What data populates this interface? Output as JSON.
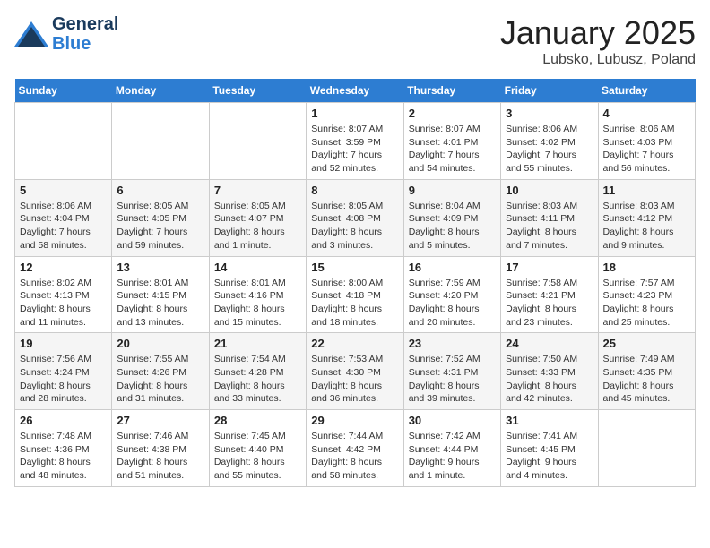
{
  "header": {
    "logo_line1": "General",
    "logo_line2": "Blue",
    "title": "January 2025",
    "subtitle": "Lubsko, Lubusz, Poland"
  },
  "weekdays": [
    "Sunday",
    "Monday",
    "Tuesday",
    "Wednesday",
    "Thursday",
    "Friday",
    "Saturday"
  ],
  "weeks": [
    [
      {
        "day": "",
        "info": ""
      },
      {
        "day": "",
        "info": ""
      },
      {
        "day": "",
        "info": ""
      },
      {
        "day": "1",
        "info": "Sunrise: 8:07 AM\nSunset: 3:59 PM\nDaylight: 7 hours and 52 minutes."
      },
      {
        "day": "2",
        "info": "Sunrise: 8:07 AM\nSunset: 4:01 PM\nDaylight: 7 hours and 54 minutes."
      },
      {
        "day": "3",
        "info": "Sunrise: 8:06 AM\nSunset: 4:02 PM\nDaylight: 7 hours and 55 minutes."
      },
      {
        "day": "4",
        "info": "Sunrise: 8:06 AM\nSunset: 4:03 PM\nDaylight: 7 hours and 56 minutes."
      }
    ],
    [
      {
        "day": "5",
        "info": "Sunrise: 8:06 AM\nSunset: 4:04 PM\nDaylight: 7 hours and 58 minutes."
      },
      {
        "day": "6",
        "info": "Sunrise: 8:05 AM\nSunset: 4:05 PM\nDaylight: 7 hours and 59 minutes."
      },
      {
        "day": "7",
        "info": "Sunrise: 8:05 AM\nSunset: 4:07 PM\nDaylight: 8 hours and 1 minute."
      },
      {
        "day": "8",
        "info": "Sunrise: 8:05 AM\nSunset: 4:08 PM\nDaylight: 8 hours and 3 minutes."
      },
      {
        "day": "9",
        "info": "Sunrise: 8:04 AM\nSunset: 4:09 PM\nDaylight: 8 hours and 5 minutes."
      },
      {
        "day": "10",
        "info": "Sunrise: 8:03 AM\nSunset: 4:11 PM\nDaylight: 8 hours and 7 minutes."
      },
      {
        "day": "11",
        "info": "Sunrise: 8:03 AM\nSunset: 4:12 PM\nDaylight: 8 hours and 9 minutes."
      }
    ],
    [
      {
        "day": "12",
        "info": "Sunrise: 8:02 AM\nSunset: 4:13 PM\nDaylight: 8 hours and 11 minutes."
      },
      {
        "day": "13",
        "info": "Sunrise: 8:01 AM\nSunset: 4:15 PM\nDaylight: 8 hours and 13 minutes."
      },
      {
        "day": "14",
        "info": "Sunrise: 8:01 AM\nSunset: 4:16 PM\nDaylight: 8 hours and 15 minutes."
      },
      {
        "day": "15",
        "info": "Sunrise: 8:00 AM\nSunset: 4:18 PM\nDaylight: 8 hours and 18 minutes."
      },
      {
        "day": "16",
        "info": "Sunrise: 7:59 AM\nSunset: 4:20 PM\nDaylight: 8 hours and 20 minutes."
      },
      {
        "day": "17",
        "info": "Sunrise: 7:58 AM\nSunset: 4:21 PM\nDaylight: 8 hours and 23 minutes."
      },
      {
        "day": "18",
        "info": "Sunrise: 7:57 AM\nSunset: 4:23 PM\nDaylight: 8 hours and 25 minutes."
      }
    ],
    [
      {
        "day": "19",
        "info": "Sunrise: 7:56 AM\nSunset: 4:24 PM\nDaylight: 8 hours and 28 minutes."
      },
      {
        "day": "20",
        "info": "Sunrise: 7:55 AM\nSunset: 4:26 PM\nDaylight: 8 hours and 31 minutes."
      },
      {
        "day": "21",
        "info": "Sunrise: 7:54 AM\nSunset: 4:28 PM\nDaylight: 8 hours and 33 minutes."
      },
      {
        "day": "22",
        "info": "Sunrise: 7:53 AM\nSunset: 4:30 PM\nDaylight: 8 hours and 36 minutes."
      },
      {
        "day": "23",
        "info": "Sunrise: 7:52 AM\nSunset: 4:31 PM\nDaylight: 8 hours and 39 minutes."
      },
      {
        "day": "24",
        "info": "Sunrise: 7:50 AM\nSunset: 4:33 PM\nDaylight: 8 hours and 42 minutes."
      },
      {
        "day": "25",
        "info": "Sunrise: 7:49 AM\nSunset: 4:35 PM\nDaylight: 8 hours and 45 minutes."
      }
    ],
    [
      {
        "day": "26",
        "info": "Sunrise: 7:48 AM\nSunset: 4:36 PM\nDaylight: 8 hours and 48 minutes."
      },
      {
        "day": "27",
        "info": "Sunrise: 7:46 AM\nSunset: 4:38 PM\nDaylight: 8 hours and 51 minutes."
      },
      {
        "day": "28",
        "info": "Sunrise: 7:45 AM\nSunset: 4:40 PM\nDaylight: 8 hours and 55 minutes."
      },
      {
        "day": "29",
        "info": "Sunrise: 7:44 AM\nSunset: 4:42 PM\nDaylight: 8 hours and 58 minutes."
      },
      {
        "day": "30",
        "info": "Sunrise: 7:42 AM\nSunset: 4:44 PM\nDaylight: 9 hours and 1 minute."
      },
      {
        "day": "31",
        "info": "Sunrise: 7:41 AM\nSunset: 4:45 PM\nDaylight: 9 hours and 4 minutes."
      },
      {
        "day": "",
        "info": ""
      }
    ]
  ]
}
